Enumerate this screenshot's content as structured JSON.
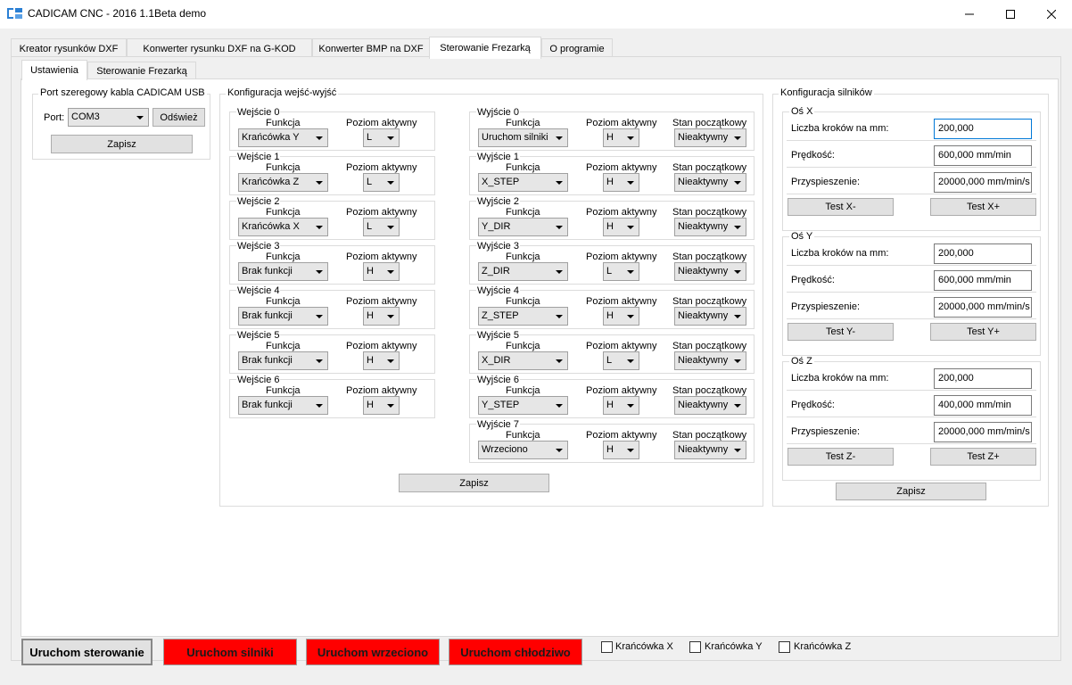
{
  "window": {
    "title": "CADICAM CNC - 2016 1.1Beta demo"
  },
  "outer_tabs": [
    "Kreator rysunków DXF",
    "Konwerter rysunku DXF na G-KOD",
    "Konwerter BMP na DXF",
    "Sterowanie Frezarką",
    "O programie"
  ],
  "inner_tabs": [
    "Ustawienia",
    "Sterowanie Frezarką"
  ],
  "serial": {
    "title": "Port szeregowy kabla CADICAM USB",
    "port_label": "Port:",
    "port_value": "COM3",
    "refresh": "Odśwież",
    "save": "Zapisz"
  },
  "io": {
    "title": "Konfiguracja wejść-wyjść",
    "col_function": "Funkcja",
    "col_level": "Poziom aktywny",
    "col_initial": "Stan początkowy",
    "save": "Zapisz",
    "inputs": [
      {
        "name": "Wejście 0",
        "func": "Krańcówka Y",
        "level": "L"
      },
      {
        "name": "Wejście 1",
        "func": "Krańcówka Z",
        "level": "L"
      },
      {
        "name": "Wejście 2",
        "func": "Krańcówka X",
        "level": "L"
      },
      {
        "name": "Wejście 3",
        "func": "Brak funkcji",
        "level": "H"
      },
      {
        "name": "Wejście 4",
        "func": "Brak funkcji",
        "level": "H"
      },
      {
        "name": "Wejście 5",
        "func": "Brak funkcji",
        "level": "H"
      },
      {
        "name": "Wejście 6",
        "func": "Brak funkcji",
        "level": "H"
      }
    ],
    "outputs": [
      {
        "name": "Wyjście 0",
        "func": "Uruchom silniki",
        "level": "H",
        "initial": "Nieaktywny"
      },
      {
        "name": "Wyjście 1",
        "func": "X_STEP",
        "level": "H",
        "initial": "Nieaktywny"
      },
      {
        "name": "Wyjście 2",
        "func": "Y_DIR",
        "level": "H",
        "initial": "Nieaktywny"
      },
      {
        "name": "Wyjście 3",
        "func": "Z_DIR",
        "level": "L",
        "initial": "Nieaktywny"
      },
      {
        "name": "Wyjście 4",
        "func": "Z_STEP",
        "level": "H",
        "initial": "Nieaktywny"
      },
      {
        "name": "Wyjście 5",
        "func": "X_DIR",
        "level": "L",
        "initial": "Nieaktywny"
      },
      {
        "name": "Wyjście 6",
        "func": "Y_STEP",
        "level": "H",
        "initial": "Nieaktywny"
      },
      {
        "name": "Wyjście 7",
        "func": "Wrzeciono",
        "level": "H",
        "initial": "Nieaktywny"
      }
    ]
  },
  "motors": {
    "title": "Konfiguracja silników",
    "steps_label": "Liczba kroków na mm:",
    "speed_label": "Prędkość:",
    "accel_label": "Przyspieszenie:",
    "save": "Zapisz",
    "axes": [
      {
        "name": "Oś X",
        "steps": "200,000",
        "speed": "600,000 mm/min",
        "accel": "20000,000 mm/min/s",
        "test_minus": "Test X-",
        "test_plus": "Test X+"
      },
      {
        "name": "Oś Y",
        "steps": "200,000",
        "speed": "600,000 mm/min",
        "accel": "20000,000 mm/min/s",
        "test_minus": "Test Y-",
        "test_plus": "Test Y+"
      },
      {
        "name": "Oś Z",
        "steps": "200,000",
        "speed": "400,000 mm/min",
        "accel": "20000,000 mm/min/s",
        "test_minus": "Test Z-",
        "test_plus": "Test Z+"
      }
    ]
  },
  "bottom": {
    "start_control": "Uruchom sterowanie",
    "start_motors": "Uruchom silniki",
    "start_spindle": "Uruchom wrzeciono",
    "start_coolant": "Uruchom chłodziwo",
    "checkboxes": [
      "Krańcówka X",
      "Krańcówka Y",
      "Krańcówka Z"
    ]
  },
  "colors": {
    "accent_red": "#ff0000",
    "focus_blue": "#0078d7"
  }
}
